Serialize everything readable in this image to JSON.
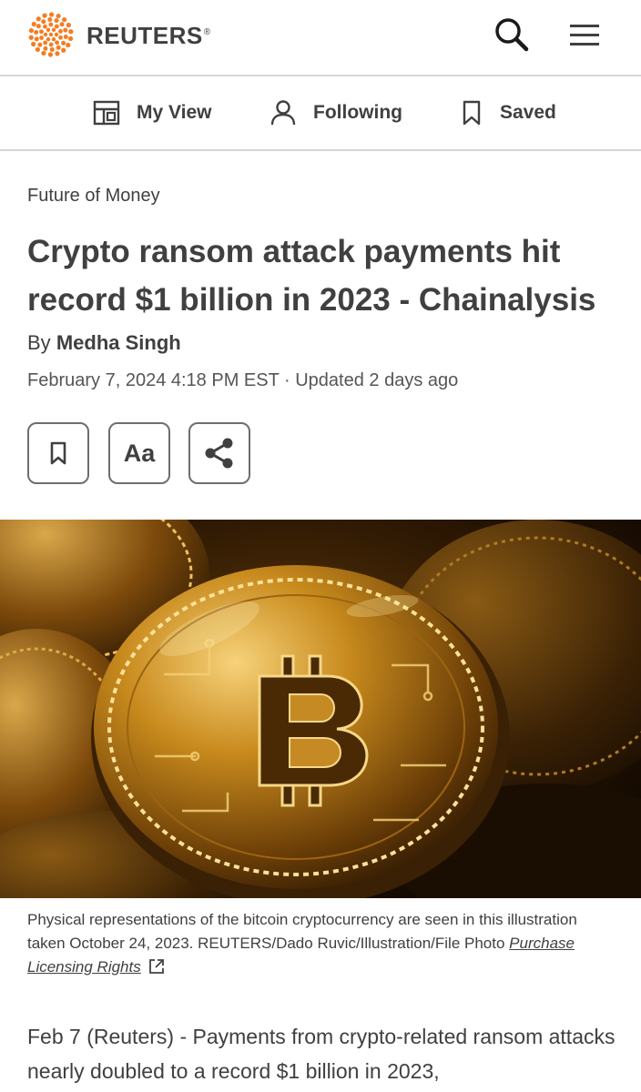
{
  "header": {
    "brand": "REUTERS",
    "brand_mark": "®",
    "icons": {
      "logo": "reuters-dot-logo",
      "search": "search-icon",
      "menu": "hamburger-menu-icon"
    }
  },
  "nav": {
    "items": [
      {
        "label": "My View",
        "icon": "layout-grid-icon"
      },
      {
        "label": "Following",
        "icon": "person-icon"
      },
      {
        "label": "Saved",
        "icon": "bookmark-icon"
      }
    ]
  },
  "article": {
    "section": "Future of Money",
    "headline": "Crypto ransom attack payments hit record $1 billion in 2023 - Chainalysis",
    "byline_prefix": "By",
    "author": "Medha Singh",
    "dateline": "February 7, 2024 4:18 PM EST · Updated 2 days ago",
    "actions": {
      "bookmark_icon": "bookmark-icon",
      "text_size_label": "Aa",
      "share_icon": "share-icon"
    },
    "image_caption": "Physical representations of the bitcoin cryptocurrency are seen in this illustration taken October 24, 2023. REUTERS/Dado Ruvic/Illustration/File Photo",
    "licensing_link": "Purchase Licensing Rights",
    "licensing_icon": "external-link-icon",
    "body_first": "Feb 7 (Reuters) - Payments from crypto-related ransom attacks nearly doubled to a record $1 billion in 2023,"
  },
  "colors": {
    "brand_orange": "#f47c20",
    "text": "#404040",
    "divider": "#d6d6d6"
  }
}
